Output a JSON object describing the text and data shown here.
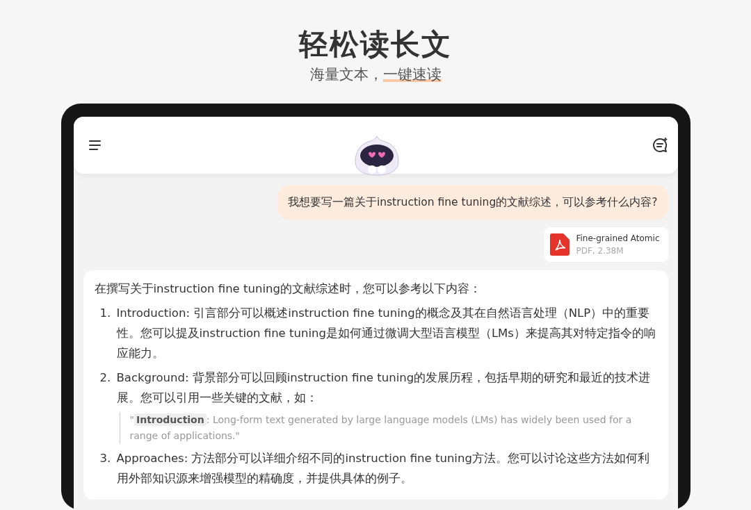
{
  "headline": {
    "title": "轻松读长文",
    "subtitle_plain": "海量文本，",
    "subtitle_marked": "一键速读"
  },
  "chat": {
    "user_message": "我想要写一篇关于instruction fine tuning的文献综述，可以参考什么内容?",
    "attachment": {
      "name": "Fine-grained Atomic",
      "meta": "PDF, 2.38M"
    },
    "answer": {
      "intro": "在撰写关于instruction fine tuning的文献综述时，您可以参考以下内容：",
      "items": [
        {
          "number": "1.",
          "text": "Introduction: 引言部分可以概述instruction fine tuning的概念及其在自然语言处理（NLP）中的重要性。您可以提及instruction fine tuning是如何通过微调大型语言模型（LMs）来提高其对特定指令的响应能力。"
        },
        {
          "number": "2.",
          "text": "Background: 背景部分可以回顾instruction fine tuning的发展历程，包括早期的研究和最近的技术进展。您可以引用一些关键的文献，如：",
          "quote": {
            "open": "\"",
            "tag": "Introduction",
            "text": ": Long-form text generated by large language models (LMs) has widely been used for a range of applications.\""
          }
        },
        {
          "number": "3.",
          "text": "Approaches: 方法部分可以详细介绍不同的instruction fine tuning方法。您可以讨论这些方法如何利用外部知识源来增强模型的精确度，并提供具体的例子。"
        }
      ]
    }
  }
}
